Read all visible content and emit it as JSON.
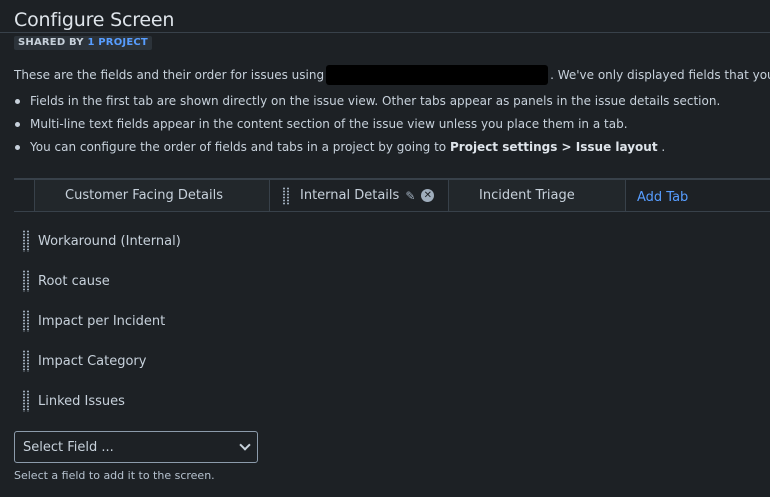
{
  "page": {
    "title": "Configure Screen",
    "badge_prefix": "SHARED BY",
    "badge_link": "1 PROJECT",
    "intro_before": "These are the fields and their order for issues using",
    "intro_after": ". We've only displayed fields that you have"
  },
  "bullets": [
    "Fields in the first tab are shown directly on the issue view. Other tabs appear as panels in the issue details section.",
    "Multi-line text fields appear in the content section of the issue view unless you place them in a tab.",
    {
      "text": "You can configure the order of fields and tabs in a project by going to",
      "bold": "Project settings > Issue layout",
      "end": "."
    }
  ],
  "tabs": [
    {
      "label": "Customer Facing Details"
    },
    {
      "label": "Internal Details",
      "selected": true
    },
    {
      "label": "Incident Triage"
    }
  ],
  "add_tab_label": "Add Tab",
  "fields": [
    {
      "label": "Workaround (Internal)"
    },
    {
      "label": "Root cause"
    },
    {
      "label": "Impact per Incident"
    },
    {
      "label": "Impact Category"
    },
    {
      "label": "Linked Issues"
    }
  ],
  "select_field": {
    "value": "Select Field ...",
    "helper": "Select a field to add it to the screen."
  },
  "icons": {
    "drag": "drag-handle-icon",
    "edit": "pencil-icon",
    "remove": "close-circle-icon",
    "dropdown": "chevron-down-icon"
  },
  "colors": {
    "background": "#1d2125",
    "link": "#579dff",
    "text": "#c7d1db"
  }
}
